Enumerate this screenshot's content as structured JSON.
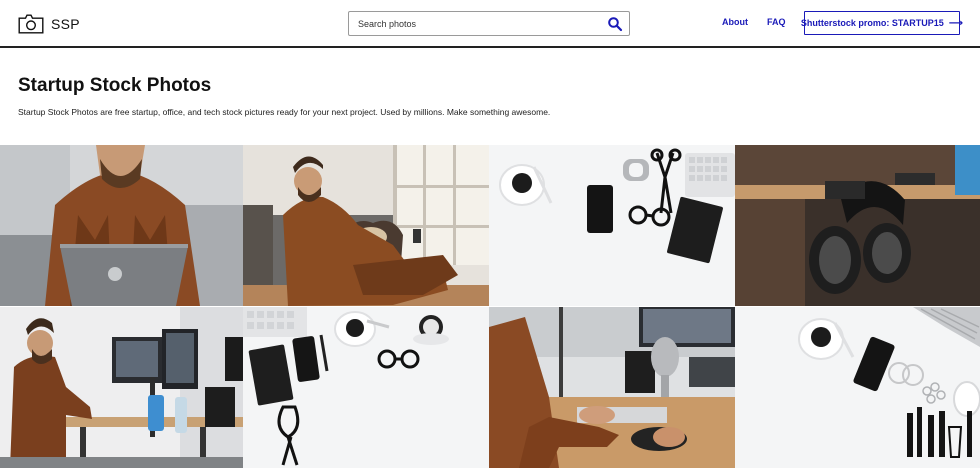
{
  "header": {
    "logo_text": "SSP",
    "search": {
      "placeholder": "Search photos"
    },
    "nav": {
      "about": "About",
      "faq": "FAQ"
    },
    "promo_label": "Shutterstock promo: STARTUP15",
    "promo_arrow": "⟶"
  },
  "hero": {
    "title": "Startup Stock Photos",
    "description": "Startup Stock Photos are free startup, office, and tech stock pictures ready for your next project. Used by millions. Make something awesome."
  },
  "colors": {
    "accent": "#1a1ab8",
    "text": "#111111",
    "header_rule": "#222222"
  },
  "icons": {
    "logo": "camera-icon",
    "search": "search-icon",
    "promo": "arrow-right-icon"
  },
  "photos": [
    {
      "id": "photo-1",
      "subject": "man in plaid shirt typing on laptop"
    },
    {
      "id": "photo-2",
      "subject": "man on couch with dog using phone"
    },
    {
      "id": "photo-3",
      "subject": "flat lay of phone, notebook, glasses and coffee"
    },
    {
      "id": "photo-4",
      "subject": "headphones hanging from desk"
    },
    {
      "id": "photo-5",
      "subject": "man working at standing desk"
    },
    {
      "id": "photo-6",
      "subject": "flat lay of notebook, phones, glasses and scissors"
    },
    {
      "id": "photo-7",
      "subject": "hands on keyboard with microphone and monitor"
    },
    {
      "id": "photo-8",
      "subject": "flat lay of coffee, phone, earrings and makeup tools"
    }
  ]
}
